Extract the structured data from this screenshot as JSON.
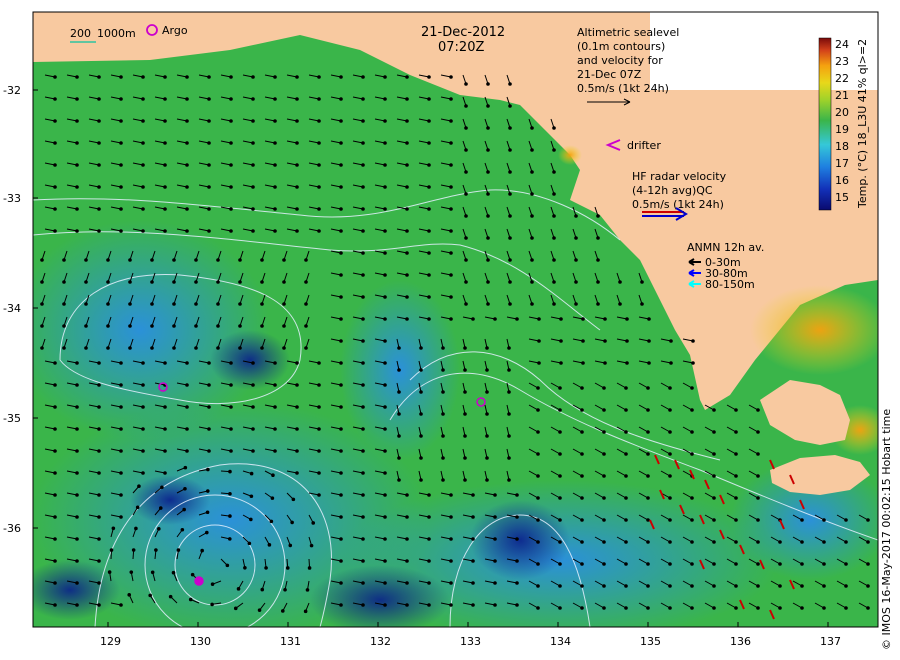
{
  "header": {
    "date": "21-Dec-2012",
    "time": "07:20Z"
  },
  "scale_labels": [
    "200",
    "1000m"
  ],
  "argo_label": "Argo",
  "altimetry_note": [
    "Altimetric sealevel",
    "(0.1m contours)",
    "and velocity for",
    "21-Dec 07Z",
    "0.5m/s (1kt 24h)"
  ],
  "drifter_label": "drifter",
  "hf_radar_note": [
    "HF radar velocity",
    "(4-12h avg)QC",
    "0.5m/s (1kt 24h)"
  ],
  "anmn": {
    "title": "ANMN 12h av.",
    "items": [
      {
        "label": "0-30m",
        "color": "#000000"
      },
      {
        "label": "30-80m",
        "color": "#0000ff"
      },
      {
        "label": "80-150m",
        "color": "#00ffff"
      }
    ]
  },
  "colorbar": {
    "title": "Temp. (°C) 18_L3U 41% ql>=2",
    "ticks": [
      "24",
      "23",
      "22",
      "21",
      "20",
      "19",
      "18",
      "17",
      "16",
      "15"
    ]
  },
  "axes": {
    "x_ticks": [
      "129",
      "130",
      "131",
      "132",
      "133",
      "134",
      "135",
      "136",
      "137"
    ],
    "y_ticks": [
      "-32",
      "-33",
      "-34",
      "-35",
      "-36"
    ]
  },
  "credit": "© IMOS 16-May-2017 00:02:15 Hobart time",
  "colors": {
    "land": "#f8c9a0",
    "sst_warm": "#f5a10f",
    "sst_mid": "#3ab54a",
    "sst_cool": "#2a8fe0",
    "sst_cold": "#0a1f8c",
    "hf_radar": "#cc0000",
    "argo": "#cc00cc"
  }
}
